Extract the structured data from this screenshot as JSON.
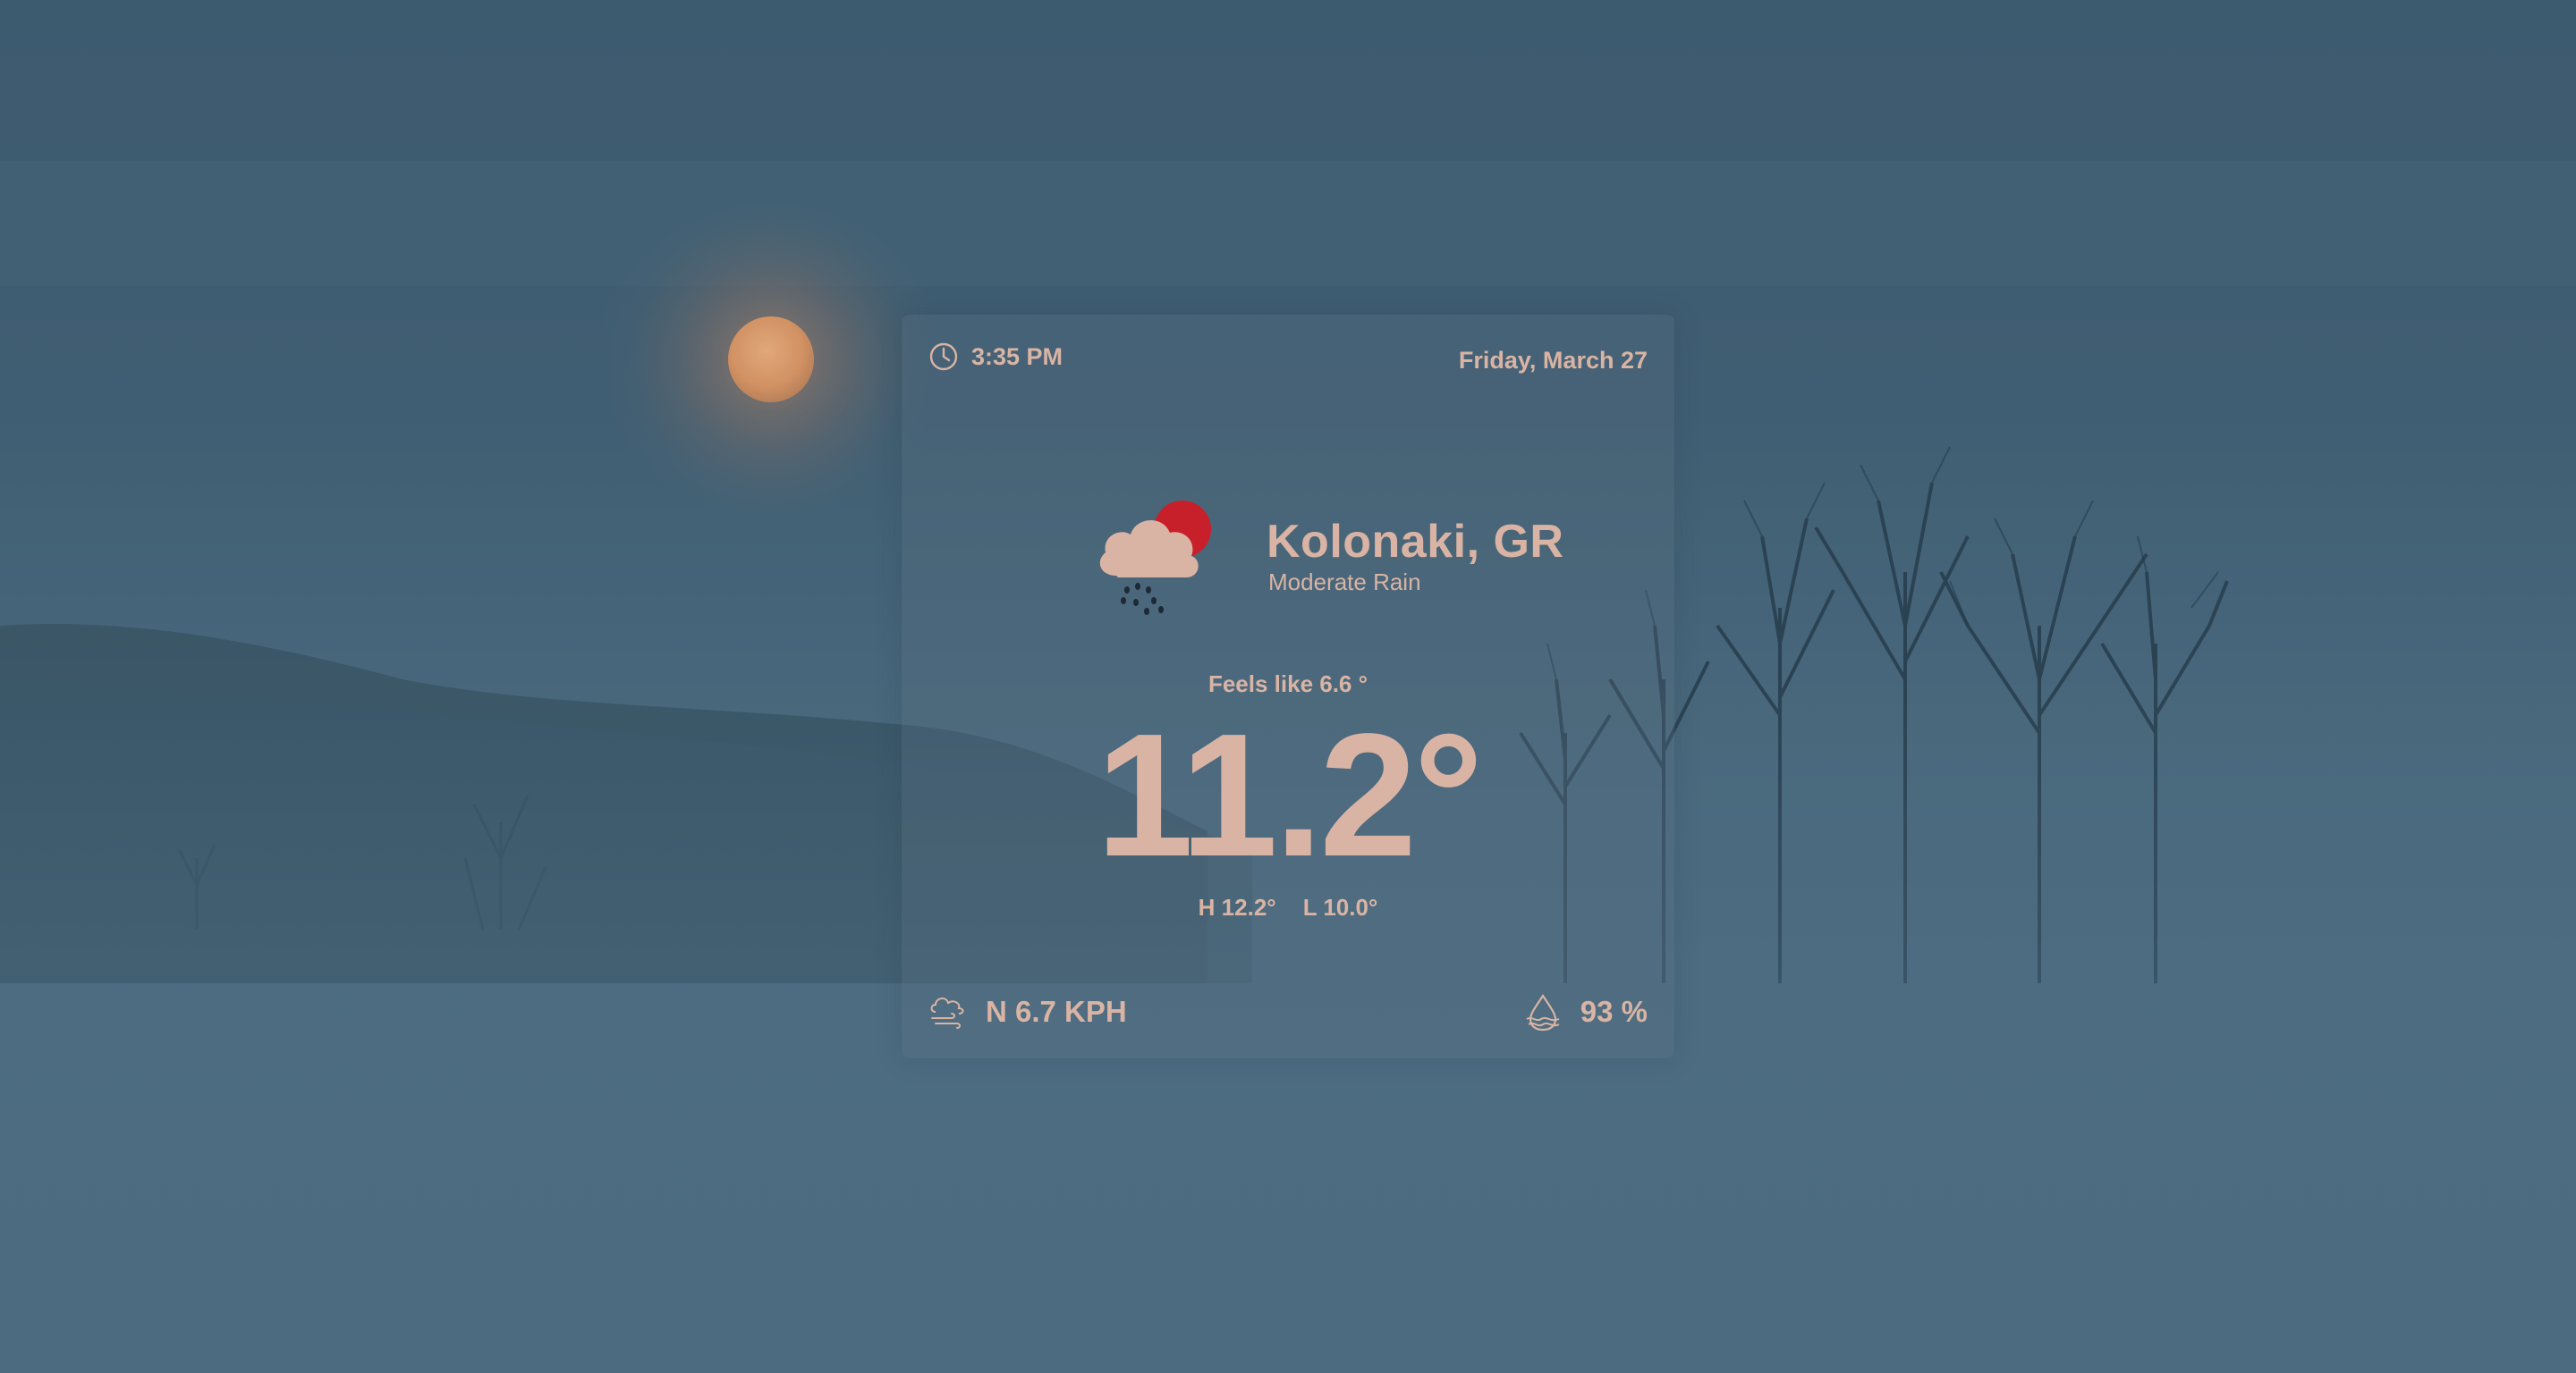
{
  "clock": {
    "time": "3:35 PM",
    "icon": "clock-icon"
  },
  "date": "Friday, March 27",
  "location": "Kolonaki, GR",
  "condition": "Moderate Rain",
  "condition_icon": "cloud-rain-sun-icon",
  "feels_like": "Feels like 6.6 °",
  "temperature": "11.2°",
  "high": "H 12.2°",
  "low": "L 10.0°",
  "wind": {
    "value": "N 6.7 KPH",
    "icon": "wind-icon"
  },
  "humidity": {
    "value": "93 %",
    "icon": "humidity-icon"
  },
  "colors": {
    "text": "#d9b4a4",
    "sun_red": "#c8202a",
    "cloud": "#d9b4a4",
    "background": "#42617a"
  }
}
